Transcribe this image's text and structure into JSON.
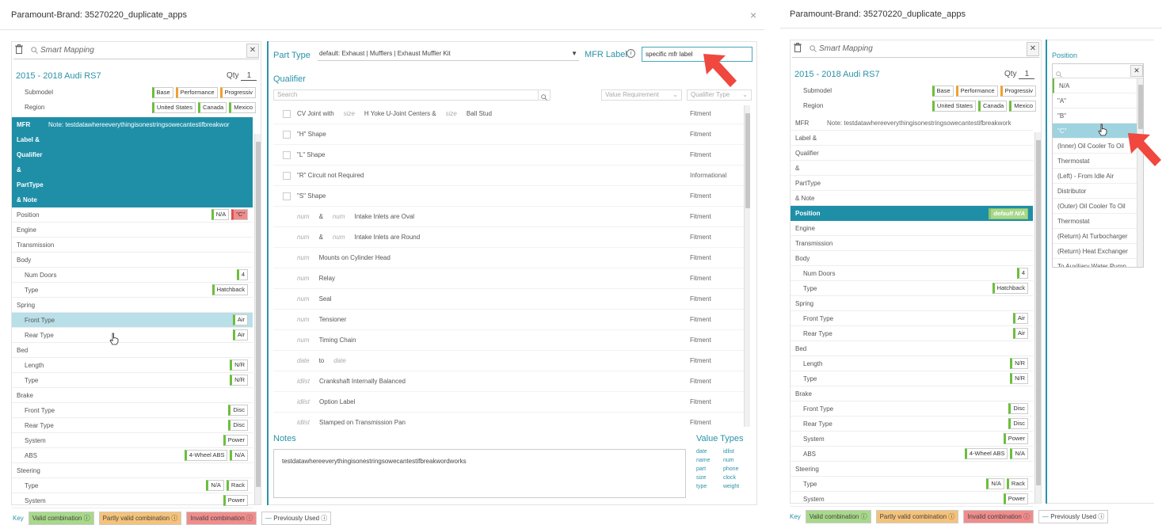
{
  "left": {
    "title": "Paramount-Brand: 35270220_duplicate_apps",
    "close": "×",
    "smart_mapping": "Smart Mapping",
    "vehicle": "2015 - 2018 Audi RS7",
    "qty_label": "Qty",
    "qty_value": "1",
    "submodel_label": "Submodel",
    "submodels": [
      "Base",
      "Performance",
      "Progressiv"
    ],
    "region_label": "Region",
    "regions": [
      "United States",
      "Canada",
      "Mexico"
    ],
    "header_lines": [
      "MFR",
      "Label &",
      "Qualifier",
      "&",
      "PartType",
      "& Note"
    ],
    "header_note": "Note:  testdatawhereeverythingisonestringsowecantestifbreakwor",
    "rows": [
      {
        "label": "Position",
        "chips": [
          "N/A",
          "\"C\""
        ],
        "indent": false
      },
      {
        "label": "Engine",
        "chips": [],
        "indent": false
      },
      {
        "label": "Transmission",
        "chips": [],
        "indent": false
      },
      {
        "label": "Body",
        "chips": [],
        "indent": false
      },
      {
        "label": "Num Doors",
        "chips": [
          "4"
        ],
        "indent": true
      },
      {
        "label": "Type",
        "chips": [
          "Hatchback"
        ],
        "indent": true
      },
      {
        "label": "Spring",
        "chips": [],
        "indent": false
      },
      {
        "label": "Front Type",
        "chips": [
          "Air"
        ],
        "indent": true
      },
      {
        "label": "Rear Type",
        "chips": [
          "Air"
        ],
        "indent": true
      },
      {
        "label": "Bed",
        "chips": [],
        "indent": false
      },
      {
        "label": "Length",
        "chips": [
          "N/R"
        ],
        "indent": true
      },
      {
        "label": "Type",
        "chips": [
          "N/R"
        ],
        "indent": true
      },
      {
        "label": "Brake",
        "chips": [],
        "indent": false
      },
      {
        "label": "Front Type",
        "chips": [
          "Disc"
        ],
        "indent": true
      },
      {
        "label": "Rear Type",
        "chips": [
          "Disc"
        ],
        "indent": true
      },
      {
        "label": "System",
        "chips": [
          "Power"
        ],
        "indent": true
      },
      {
        "label": "ABS",
        "chips": [
          "4-Wheel ABS",
          "N/A"
        ],
        "indent": true
      },
      {
        "label": "Steering",
        "chips": [],
        "indent": false
      },
      {
        "label": "Type",
        "chips": [
          "N/A",
          "Rack"
        ],
        "indent": true
      },
      {
        "label": "System",
        "chips": [
          "Power"
        ],
        "indent": true
      }
    ]
  },
  "center": {
    "part_type_label": "Part Type",
    "part_type_value": "default: Exhaust  |  Mufflers  |  Exhaust Muffler Kit",
    "mfr_label": "MFR Label",
    "mfr_value": "specific mfr label",
    "qualifier_title": "Qualifier",
    "search_placeholder": "Search",
    "value_requirement": "Value Requirement",
    "qualifier_type": "Qualifier Type",
    "qualifiers": [
      {
        "parts": [
          "CV Joint with",
          "size",
          "H Yoke U-Joint Centers &",
          "size",
          "Ball Stud"
        ],
        "type": "Fitment"
      },
      {
        "parts": [
          "\"H\" Shape"
        ],
        "type": "Fitment"
      },
      {
        "parts": [
          "\"L\" Shape"
        ],
        "type": "Fitment"
      },
      {
        "parts": [
          "\"R\" Circuit not Required"
        ],
        "type": "Informational"
      },
      {
        "parts": [
          "\"S\" Shape"
        ],
        "type": "Fitment"
      },
      {
        "parts": [
          "num",
          "&",
          "num",
          "Intake Inlets are Oval"
        ],
        "type": "Fitment"
      },
      {
        "parts": [
          "num",
          "&",
          "num",
          "Intake Inlets are Round"
        ],
        "type": "Fitment"
      },
      {
        "parts": [
          "num",
          "Mounts on Cylinder Head"
        ],
        "type": "Fitment"
      },
      {
        "parts": [
          "num",
          "Relay"
        ],
        "type": "Fitment"
      },
      {
        "parts": [
          "num",
          "Seal"
        ],
        "type": "Fitment"
      },
      {
        "parts": [
          "num",
          "Tensioner"
        ],
        "type": "Fitment"
      },
      {
        "parts": [
          "num",
          "Timing Chain"
        ],
        "type": "Fitment"
      },
      {
        "parts": [
          "date",
          "to",
          "date"
        ],
        "type": "Fitment"
      },
      {
        "parts": [
          "idlist",
          "Crankshaft Internally Balanced"
        ],
        "type": "Fitment"
      },
      {
        "parts": [
          "idlist",
          "Option Label"
        ],
        "type": "Fitment"
      },
      {
        "parts": [
          "idlist",
          "Stamped on Transmission Pan"
        ],
        "type": "Fitment"
      }
    ],
    "notes_title": "Notes",
    "notes_text": "testdatawhereeverythingisonestringsowecantestifbreakwordworks",
    "value_types_title": "Value Types",
    "value_types": [
      "date",
      "idlist",
      "name",
      "num",
      "part",
      "phone",
      "size",
      "clock",
      "type",
      "weight"
    ]
  },
  "key": {
    "label": "Key",
    "valid": "Valid combination",
    "partly": "Partly valid combination",
    "invalid": "Invalid combination",
    "previous": "Previously Used"
  },
  "right": {
    "title": "Paramount-Brand: 35270220_duplicate_apps",
    "smart_mapping": "Smart Mapping",
    "vehicle": "2015 - 2018 Audi RS7",
    "qty_label": "Qty",
    "qty_value": "1",
    "submodel_label": "Submodel",
    "submodels": [
      "Base",
      "Performance",
      "Progressiv"
    ],
    "region_label": "Region",
    "regions": [
      "United States",
      "Canada",
      "Mexico"
    ],
    "header_lines": [
      "MFR",
      "Label &",
      "Qualifier",
      "&",
      "PartType",
      "& Note"
    ],
    "header_note": "Note:  testdatawhereeverythingisonestringsowecantestifbreakwork",
    "position_label": "Position",
    "position_default": "default N/A",
    "rows": [
      {
        "label": "Engine",
        "chips": [],
        "indent": false
      },
      {
        "label": "Transmission",
        "chips": [],
        "indent": false
      },
      {
        "label": "Body",
        "chips": [],
        "indent": false
      },
      {
        "label": "Num Doors",
        "chips": [
          "4"
        ],
        "indent": true
      },
      {
        "label": "Type",
        "chips": [
          "Hatchback"
        ],
        "indent": true
      },
      {
        "label": "Spring",
        "chips": [],
        "indent": false
      },
      {
        "label": "Front Type",
        "chips": [
          "Air"
        ],
        "indent": true
      },
      {
        "label": "Rear Type",
        "chips": [
          "Air"
        ],
        "indent": true
      },
      {
        "label": "Bed",
        "chips": [],
        "indent": false
      },
      {
        "label": "Length",
        "chips": [
          "N/R"
        ],
        "indent": true
      },
      {
        "label": "Type",
        "chips": [
          "N/R"
        ],
        "indent": true
      },
      {
        "label": "Brake",
        "chips": [],
        "indent": false
      },
      {
        "label": "Front Type",
        "chips": [
          "Disc"
        ],
        "indent": true
      },
      {
        "label": "Rear Type",
        "chips": [
          "Disc"
        ],
        "indent": true
      },
      {
        "label": "System",
        "chips": [
          "Power"
        ],
        "indent": true
      },
      {
        "label": "ABS",
        "chips": [
          "4-Wheel ABS",
          "N/A"
        ],
        "indent": true
      },
      {
        "label": "Steering",
        "chips": [],
        "indent": false
      },
      {
        "label": "Type",
        "chips": [
          "N/A",
          "Rack"
        ],
        "indent": true
      },
      {
        "label": "System",
        "chips": [
          "Power"
        ],
        "indent": true
      }
    ],
    "position_panel_title": "Position",
    "position_options": [
      "N/A",
      "\"A\"",
      "\"B\"",
      "\"C\"",
      "(Inner) Oil Cooler To Oil",
      "Thermostat",
      "(Left) - From Idle Air",
      "Distributor",
      "(Outer) Oil Cooler To Oil",
      "Thermostat",
      "(Return) At Turbocharger",
      "(Return) Heat Exchanger",
      "To Auxiliary Water Pump"
    ]
  },
  "colors": {
    "accent": "#1f8fa8",
    "valid": "#a8d88a",
    "partly": "#f5c27a",
    "invalid": "#f08c8c",
    "arrow": "#f0473f"
  }
}
